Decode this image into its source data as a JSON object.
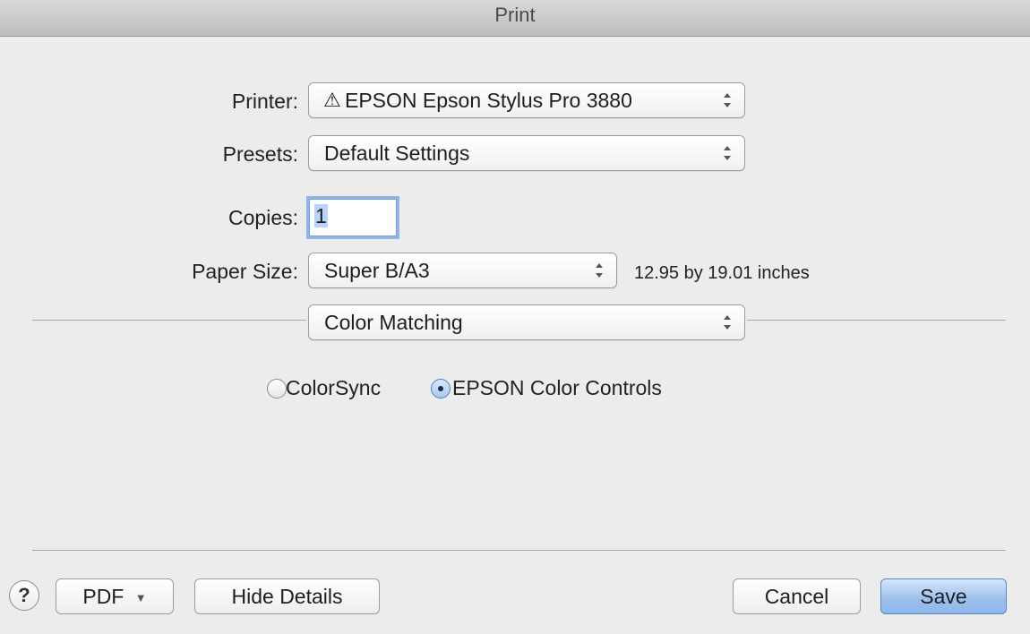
{
  "window": {
    "title": "Print"
  },
  "printer": {
    "label": "Printer:",
    "value": "EPSON Epson Stylus Pro 3880",
    "warning_icon": "warning-icon"
  },
  "presets": {
    "label": "Presets:",
    "value": "Default Settings"
  },
  "copies": {
    "label": "Copies:",
    "value": "1"
  },
  "paper_size": {
    "label": "Paper Size:",
    "value": "Super B/A3",
    "dimensions": "12.95 by 19.01 inches"
  },
  "pane": {
    "value": "Color Matching"
  },
  "color_mode": {
    "options": [
      {
        "label": "ColorSync",
        "selected": false
      },
      {
        "label": "EPSON Color Controls",
        "selected": true
      }
    ]
  },
  "footer": {
    "help": "?",
    "pdf_label": "PDF",
    "hide_details_label": "Hide Details",
    "cancel_label": "Cancel",
    "save_label": "Save"
  },
  "colors": {
    "accent": "#8fb6ea",
    "default_button": "#9fc2ee"
  }
}
